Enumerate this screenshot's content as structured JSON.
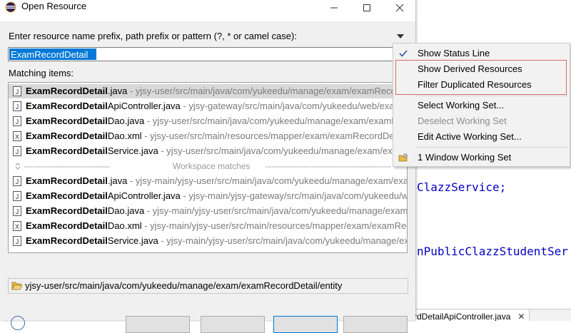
{
  "dialog": {
    "title": "Open Resource",
    "prompt": "Enter resource name prefix, path prefix or pattern (?, * or camel case):",
    "search_value": "ExamRecordDetail",
    "matching_label": "Matching items:",
    "location": "yjsy-user/src/main/java/com/yukeedu/manage/exam/examRecordDetail/entity"
  },
  "results": [
    {
      "match": "ExamRecordDetail",
      "rest": ".java",
      "path": "yjsy-user/src/main/java/com/yukeedu/manage/exam/examRecordDetail/entity",
      "icon": "java-file-icon",
      "selected": true
    },
    {
      "match": "ExamRecordDetail",
      "rest": "ApiController.java",
      "path": "yjsy-gateway/src/main/java/com/yukeedu/web/exam/examRecordDetail",
      "icon": "java-file-icon"
    },
    {
      "match": "ExamRecordDetail",
      "rest": "Dao.java",
      "path": "yjsy-user/src/main/java/com/yukeedu/manage/exam/examRecordDetail/dao",
      "icon": "java-file-icon"
    },
    {
      "match": "ExamRecordDetail",
      "rest": "Dao.xml",
      "path": "yjsy-user/src/main/resources/mapper/exam/examRecordDetail",
      "icon": "xml-file-icon"
    },
    {
      "match": "ExamRecordDetail",
      "rest": "Service.java",
      "path": "yjsy-user/src/main/java/com/yukeedu/manage/exam/examRecordDetail/service",
      "icon": "java-file-icon"
    }
  ],
  "workspace_separator": {
    "dashes": "------------------------------",
    "label": "Workspace matches",
    "dashes_right": "--------------------------------------------"
  },
  "workspace_results": [
    {
      "match": "ExamRecordDetail",
      "rest": ".java",
      "path": "yjsy-main/yjsy-user/src/main/java/com/yukeedu/manage/exam/examRecordDetail/entity",
      "icon": "java-file-icon"
    },
    {
      "match": "ExamRecordDetail",
      "rest": "ApiController.java",
      "path": "yjsy-main/yjsy-gateway/src/main/java/com/yukeedu/web/exam",
      "icon": "java-file-icon"
    },
    {
      "match": "ExamRecordDetail",
      "rest": "Dao.java",
      "path": "yjsy-main/yjsy-user/src/main/java/com/yukeedu/manage/exam/examRecordDetail",
      "icon": "java-file-icon"
    },
    {
      "match": "ExamRecordDetail",
      "rest": "Dao.xml",
      "path": "yjsy-main/yjsy-user/src/main/resources/mapper/exam/examRecordDetail",
      "icon": "xml-file-icon"
    },
    {
      "match": "ExamRecordDetail",
      "rest": "Service.java",
      "path": "yjsy-main/yjsy-user/src/main/java/com/yukeedu/manage/exam/examRecordDetail",
      "icon": "java-file-icon"
    }
  ],
  "menu": {
    "show_status_line": "Show Status Line",
    "show_derived": "Show Derived Resources",
    "filter_duplicated": "Filter Duplicated Resources",
    "select_working_set": "Select Working Set...",
    "deselect_working_set": "Deselect Working Set",
    "edit_working_set": "Edit Active Working Set...",
    "window_working_set": "1 Window Working Set"
  },
  "editor": {
    "line1": "ClazzService;",
    "line2": "nPublicClazzStudentSer",
    "tab_label": "rdDetailApiController.java",
    "tab_close": "✕"
  },
  "colors": {
    "selection": "#0078d7",
    "highlight_outline": "#e06666",
    "code_blue": "#0000c0"
  }
}
